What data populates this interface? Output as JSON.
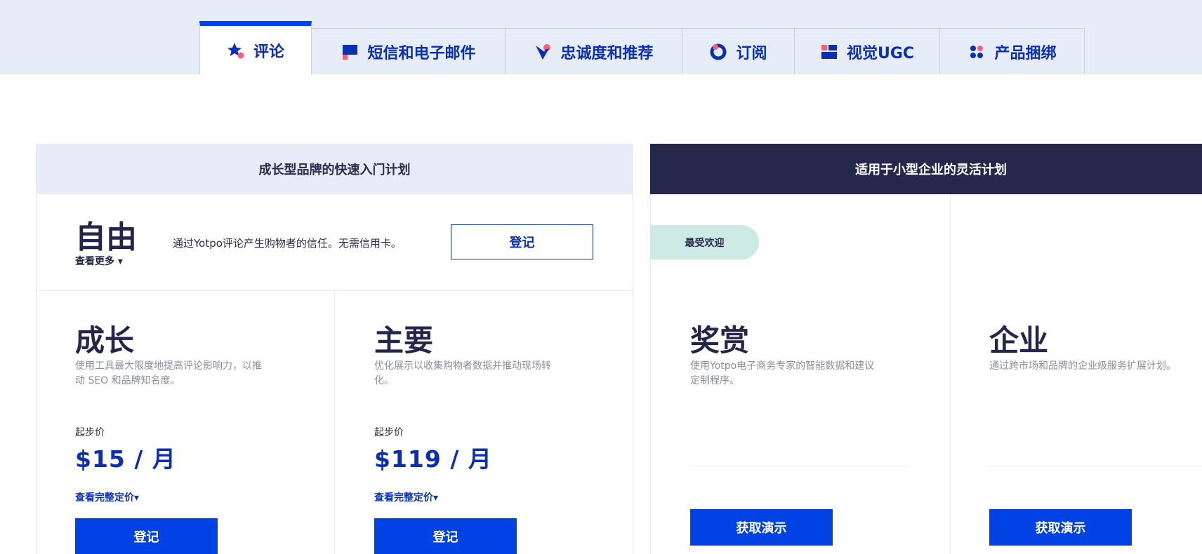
{
  "tabs": [
    {
      "label": "评论",
      "icon": "star-icon",
      "active": true
    },
    {
      "label": "短信和电子邮件",
      "icon": "message-icon",
      "active": false
    },
    {
      "label": "忠诚度和推荐",
      "icon": "heart-icon",
      "active": false
    },
    {
      "label": "订阅",
      "icon": "subscription-icon",
      "active": false
    },
    {
      "label": "视觉UGC",
      "icon": "gallery-icon",
      "active": false
    },
    {
      "label": "产品捆绑",
      "icon": "bundle-icon",
      "active": false
    }
  ],
  "groups": {
    "left_header": "成长型品牌的快速入门计划",
    "right_header": "适用于小型企业的灵活计划"
  },
  "free": {
    "title": "自由",
    "more": "查看更多 ▾",
    "desc": "通过Yotpo评论产生购物者的信任。无需信用卡。",
    "button": "登记"
  },
  "plans": [
    {
      "title": "成长",
      "desc": "使用工具最大限度地提高评论影响力，以推动 SEO 和品牌知名度。",
      "from": "起步价",
      "price": "$15 / 月",
      "full": "查看完整定价▾",
      "button": "登记"
    },
    {
      "title": "主要",
      "desc": "优化展示以收集购物者数据并推动现场转化。",
      "from": "起步价",
      "price": "$119 / 月",
      "full": "查看完整定价▾",
      "button": "登记"
    },
    {
      "title": "奖赏",
      "desc": "使用Yotpo电子商务专家的智能数据和建议定制程序。",
      "button": "获取演示"
    },
    {
      "title": "企业",
      "desc": "通过跨市场和品牌的企业级服务扩展计划。",
      "button": "获取演示"
    }
  ],
  "badge": "最受欢迎",
  "colors": {
    "accent": "#0042e4",
    "navy": "#25274c",
    "badge": "#cdeae5",
    "tint": "#e6edf8",
    "pink": "#ff5c7a"
  }
}
